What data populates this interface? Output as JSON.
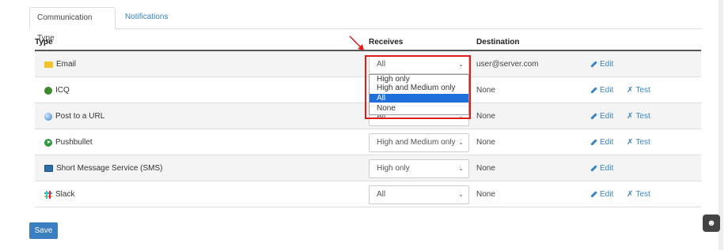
{
  "tabs": [
    {
      "label": "Communication Type"
    },
    {
      "label": "Notifications"
    }
  ],
  "table": {
    "headers": {
      "type": "Type",
      "receives": "Receives",
      "destination": "Destination"
    },
    "rows": [
      {
        "type": "Email",
        "icon": "email-icon",
        "receives": "All",
        "destination": "user@server.com",
        "edit": "Edit",
        "test": ""
      },
      {
        "type": "ICQ",
        "icon": "icq-icon",
        "receives": "",
        "destination": "None",
        "edit": "Edit",
        "test": "Test"
      },
      {
        "type": "Post to a URL",
        "icon": "globe-icon",
        "receives": "All",
        "destination": "None",
        "edit": "Edit",
        "test": "Test"
      },
      {
        "type": "Pushbullet",
        "icon": "pushbullet-icon",
        "receives": "High and Medium only",
        "destination": "None",
        "edit": "Edit",
        "test": "Test"
      },
      {
        "type": "Short Message Service (SMS)",
        "icon": "sms-icon",
        "receives": "High only",
        "destination": "None",
        "edit": "Edit",
        "test": ""
      },
      {
        "type": "Slack",
        "icon": "slack-icon",
        "receives": "All",
        "destination": "None",
        "edit": "Edit",
        "test": "Test"
      }
    ]
  },
  "dropdown": {
    "options": [
      "High only",
      "High and Medium only",
      "All",
      "None"
    ],
    "selected": "All"
  },
  "save_label": "Save",
  "colors": {
    "link": "#3a84c4",
    "primary_button": "#3a7fc1",
    "highlight_box": "#e21b1b",
    "selected_option": "#1e6fd9"
  }
}
